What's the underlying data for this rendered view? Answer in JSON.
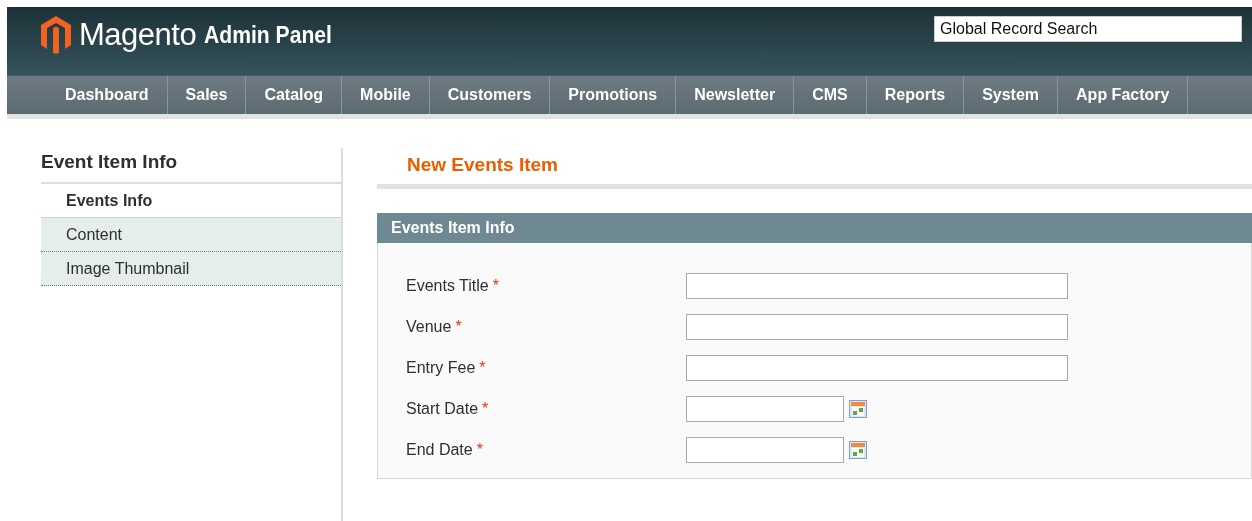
{
  "header": {
    "logo_text": "Magento",
    "logo_suffix": "Admin Panel",
    "search": {
      "placeholder": "Global Record Search"
    }
  },
  "nav": [
    {
      "label": "Dashboard"
    },
    {
      "label": "Sales"
    },
    {
      "label": "Catalog"
    },
    {
      "label": "Mobile"
    },
    {
      "label": "Customers"
    },
    {
      "label": "Promotions"
    },
    {
      "label": "Newsletter"
    },
    {
      "label": "CMS"
    },
    {
      "label": "Reports"
    },
    {
      "label": "System"
    },
    {
      "label": "App Factory"
    }
  ],
  "sidebar": {
    "title": "Event Item Info",
    "items": [
      {
        "label": "Events Info",
        "selected": true
      },
      {
        "label": "Content",
        "selected": false
      },
      {
        "label": "Image Thumbnail",
        "selected": false
      }
    ]
  },
  "page_title": "New Events Item",
  "fieldset": {
    "title": "Events Item Info",
    "fields": [
      {
        "label": "Events Title",
        "mark": "*",
        "kind": "text"
      },
      {
        "label": "Venue",
        "mark": "*",
        "kind": "text"
      },
      {
        "label": "Entry Fee",
        "mark": "*",
        "kind": "text"
      },
      {
        "label": "Start Date",
        "mark": "*",
        "kind": "date"
      },
      {
        "label": "End Date",
        "mark": "*",
        "kind": "date"
      }
    ]
  }
}
